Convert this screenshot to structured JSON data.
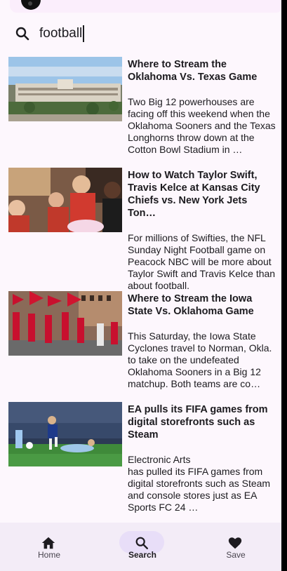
{
  "search": {
    "query": "football"
  },
  "results": [
    {
      "title": "Where to Stream the Oklahoma Vs. Texas Game",
      "description": "Two Big 12 powerhouses are facing off this weekend when the Oklahoma Sooners and the Texas Longhorns throw down at the Cotton Bowl Stadium in …"
    },
    {
      "title": "How to Watch Taylor Swift, Travis Kelce at Kansas City Chiefs vs. New York Jets Ton…",
      "description": "For millions of Swifties, the NFL Sunday Night Football game on Peacock NBC will be more about Taylor Swift and Travis Kelce than about football."
    },
    {
      "title": "Where to Stream the Iowa State Vs. Oklahoma Game",
      "description": "This Saturday, the Iowa State Cyclones travel to Norman, Okla. to take on the undefeated Oklahoma Sooners in a Big 12 matchup. Both teams are co…"
    },
    {
      "title": "EA pulls its FIFA games from digital storefronts such as Steam",
      "description": "Electronic Arts\n has pulled its FIFA games from digital storefronts such as Steam and console stores just as EA Sports FC 24 …"
    }
  ],
  "nav": {
    "home": "Home",
    "search": "Search",
    "save": "Save",
    "active": "search"
  },
  "colors": {
    "background": "#fdf7fd",
    "nav_bg": "#f3ecf7",
    "active_pill": "#e8def8"
  },
  "icons": {
    "search": "search-icon",
    "home": "home-icon",
    "save": "heart-icon"
  }
}
